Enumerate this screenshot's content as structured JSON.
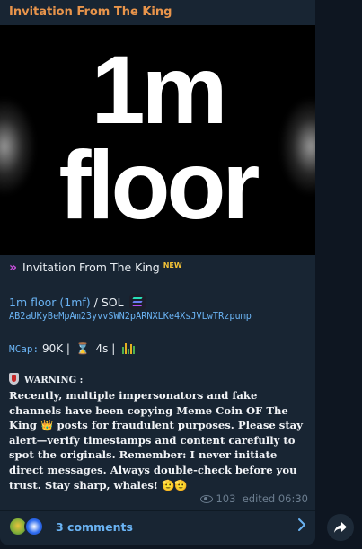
{
  "channel": {
    "title": "Invitation From The King"
  },
  "media": {
    "line1": "1m",
    "line2": "floor"
  },
  "post": {
    "header_chevrons": "»",
    "header_text": "Invitation From The King",
    "header_badge": "NEW",
    "token_link": "1m floor (1mf)",
    "pair_sep": " / SOL ",
    "address": "AB2aUKyBeMpAm23yvvSWN2pARNXLKe4XsJVLwTRzpump",
    "mcap_label": "MCap:",
    "mcap_value": " 90K | ",
    "age_value": " 4s | ",
    "warning_label": "WARNING :",
    "warning_body_1": "Recently, multiple impersonators and fake channels have been copying Meme Coin OF The King ",
    "warning_crown": "👑",
    "warning_body_2": " posts for fraudulent purposes. Please stay alert—verify timestamps and content carefully to spot the originals. Remember: I never initiate direct messages. Always double-check before you trust. Stay sharp, whales! ",
    "warning_emojis": "🫡🫡"
  },
  "meta": {
    "views": "103",
    "edited": "edited 06:30"
  },
  "comments": {
    "label": "3 comments"
  },
  "icons": {
    "chevrons": "double-chevron-right-icon",
    "solana": "solana-logo-icon",
    "hourglass": "hourglass-icon",
    "candles": "candlestick-icon",
    "shield": "shield-icon",
    "eye": "eye-icon",
    "share": "share-icon",
    "chevron": "chevron-right-icon"
  },
  "colors": {
    "background": "#0e1621",
    "bubble": "#182533",
    "title": "#e8944b",
    "link": "#6ab3f3",
    "badge": "#f3c237",
    "muted": "#6c7e90"
  }
}
